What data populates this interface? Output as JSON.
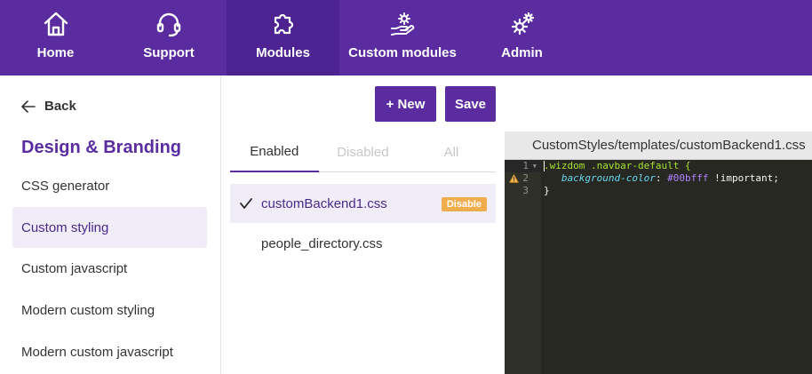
{
  "nav": {
    "items": [
      {
        "label": "Home",
        "icon": "home-icon"
      },
      {
        "label": "Support",
        "icon": "headset-icon"
      },
      {
        "label": "Modules",
        "icon": "puzzle-icon"
      },
      {
        "label": "Custom modules",
        "icon": "hand-gear-icon"
      },
      {
        "label": "Admin",
        "icon": "gears-icon"
      }
    ],
    "active": "Modules",
    "color": "#5a2ca0"
  },
  "sidebar": {
    "back_label": "Back",
    "title": "Design & Branding",
    "items": [
      {
        "label": "CSS generator"
      },
      {
        "label": "Custom styling"
      },
      {
        "label": "Custom javascript"
      },
      {
        "label": "Modern custom styling"
      },
      {
        "label": "Modern custom javascript"
      }
    ],
    "active": "Custom styling"
  },
  "toolbar": {
    "new_label": "+ New",
    "save_label": "Save"
  },
  "tabs": [
    {
      "label": "Enabled"
    },
    {
      "label": "Disabled"
    },
    {
      "label": "All"
    }
  ],
  "active_tab": "Enabled",
  "files": [
    {
      "name": "customBackend1.css",
      "badge": "Disable"
    },
    {
      "name": "people_directory.css"
    }
  ],
  "selected_file": "customBackend1.css",
  "editor": {
    "path": "CustomStyles/templates/customBackend1.css",
    "line_numbers": [
      "1",
      "2",
      "3"
    ],
    "code": {
      "line1": ".wizdom .navbar-default {",
      "line2_prop": "background-color",
      "line2_colon": ": ",
      "line2_value": "#00bfff",
      "line2_rest": " !important;",
      "line3": "}"
    },
    "warning_line": "2"
  }
}
